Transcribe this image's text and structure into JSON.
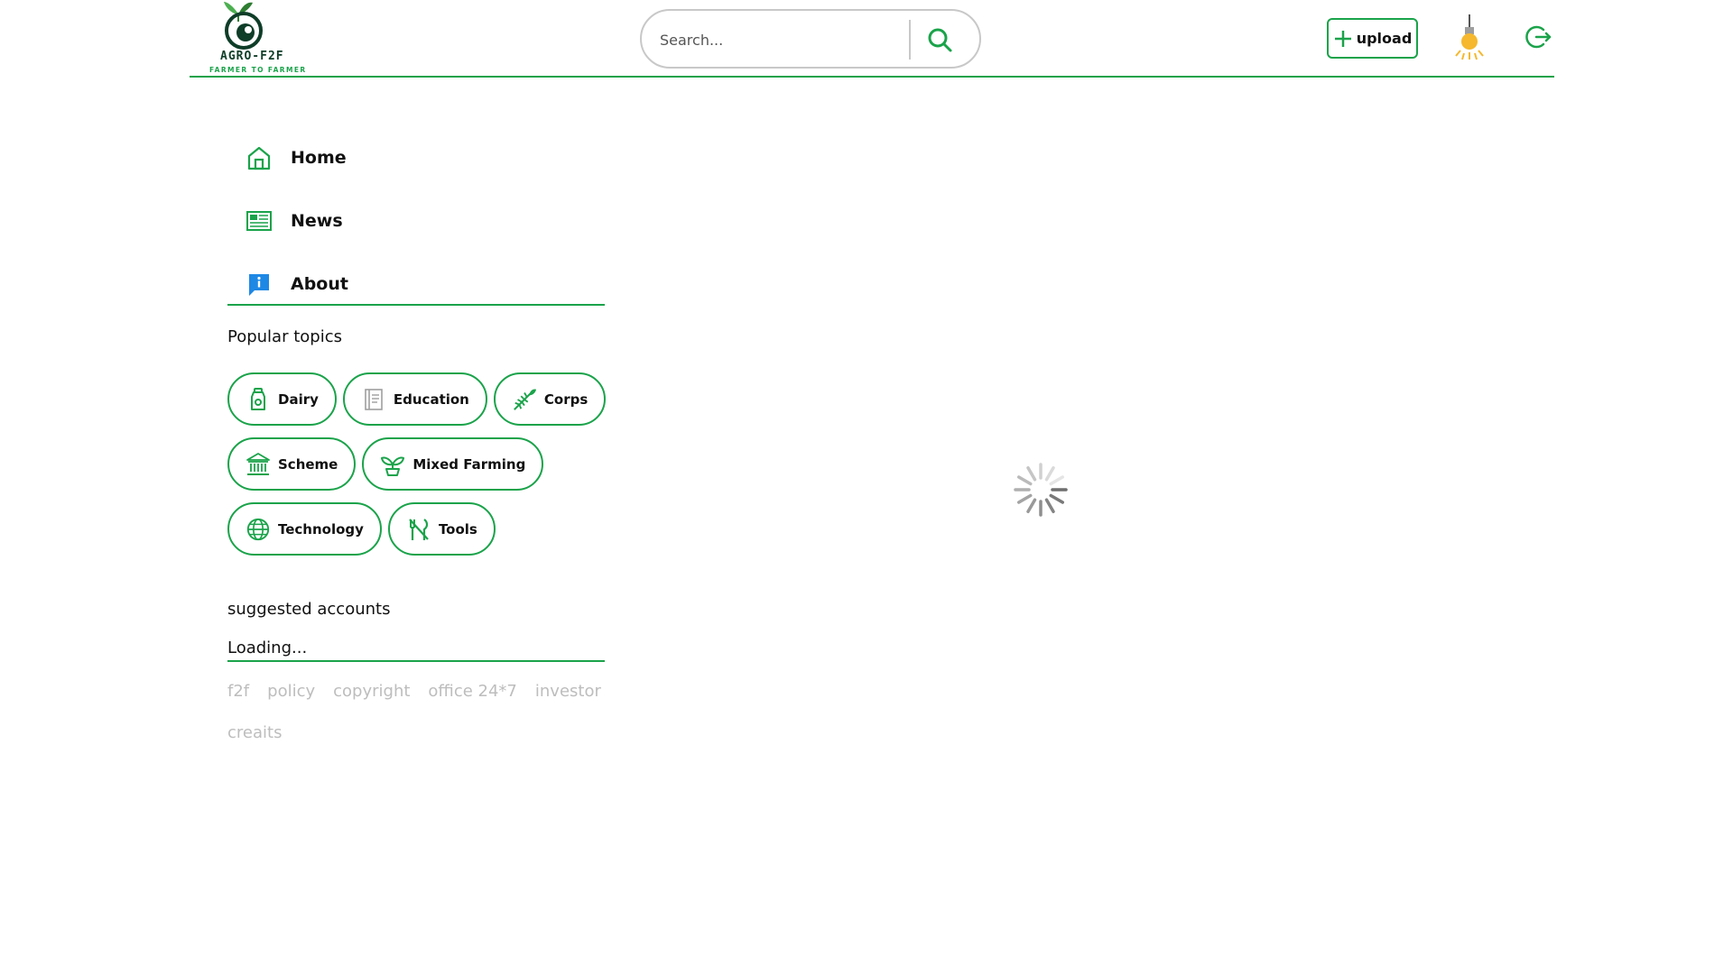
{
  "header": {
    "logo_title": "AGRO-F2F",
    "logo_subtitle": "FARMER TO FARMER",
    "search_placeholder": "Search...",
    "upload_label": "upload"
  },
  "nav": {
    "items": [
      {
        "label": "Home",
        "icon": "home-icon"
      },
      {
        "label": "News",
        "icon": "newspaper-icon"
      },
      {
        "label": "About",
        "icon": "info-icon"
      }
    ]
  },
  "popular_topics": {
    "title": "Popular topics",
    "chips": [
      {
        "label": "Dairy",
        "icon": "milk-bottle-icon"
      },
      {
        "label": "Education",
        "icon": "book-icon"
      },
      {
        "label": "Corps",
        "icon": "crop-icon"
      },
      {
        "label": "Scheme",
        "icon": "bank-icon"
      },
      {
        "label": "Mixed Farming",
        "icon": "sprout-icon"
      },
      {
        "label": "Technology",
        "icon": "globe-icon"
      },
      {
        "label": "Tools",
        "icon": "tools-icon"
      }
    ]
  },
  "suggested_accounts": {
    "title": "suggested accounts",
    "status": "Loading..."
  },
  "footer": {
    "links": [
      "f2f",
      "policy",
      "copyright",
      "office 24*7",
      "investor",
      "creaits"
    ]
  },
  "colors": {
    "accent": "#1aa34a",
    "info_blue": "#1e88e5",
    "footer_link": "#bdbdbd",
    "bulb": "#f5b82e"
  }
}
